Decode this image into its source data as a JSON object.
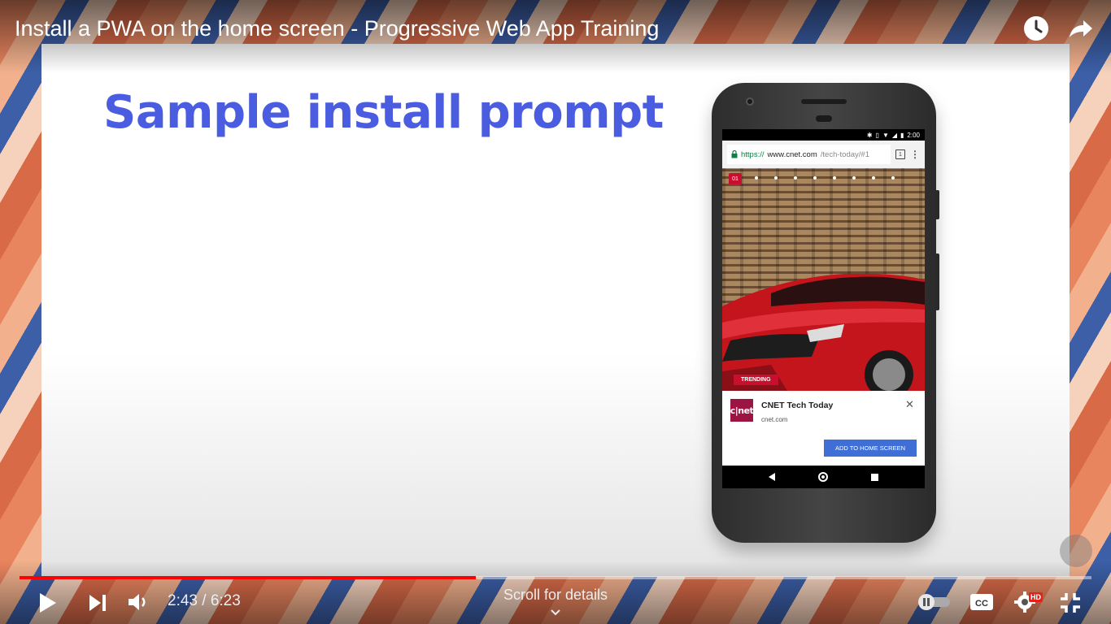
{
  "video": {
    "title": "Install a PWA on the home screen - Progressive Web App Training",
    "watch_later_icon": "clock-icon",
    "share_icon": "share-icon"
  },
  "slide": {
    "heading": "Sample install prompt"
  },
  "phone": {
    "status_time": "2:00",
    "status_icons": [
      "bluetooth-icon",
      "vibrate-icon",
      "wifi-icon",
      "signal-icon",
      "battery-icon"
    ],
    "url_secure": "https://",
    "url_host": "www.cnet.com",
    "url_path": "/tech-today/#1",
    "tab_count": "1",
    "slide_badge": "01",
    "trending_label": "TRENDING",
    "install_banner": {
      "app_name": "CNET Tech Today",
      "app_domain": "cnet.com",
      "logo_text": "c|net",
      "close_symbol": "✕",
      "button_label": "ADD TO HOME SCREEN"
    }
  },
  "player": {
    "current_time": "2:43",
    "duration": "6:23",
    "time_display": "2:43 / 6:23",
    "progress_fraction": 0.4256,
    "scroll_hint": "Scroll for details",
    "hd_badge": "HD",
    "colors": {
      "progress_played": "#ff0000",
      "heading": "#4a5de0",
      "install_button": "#3f6fd6"
    }
  }
}
